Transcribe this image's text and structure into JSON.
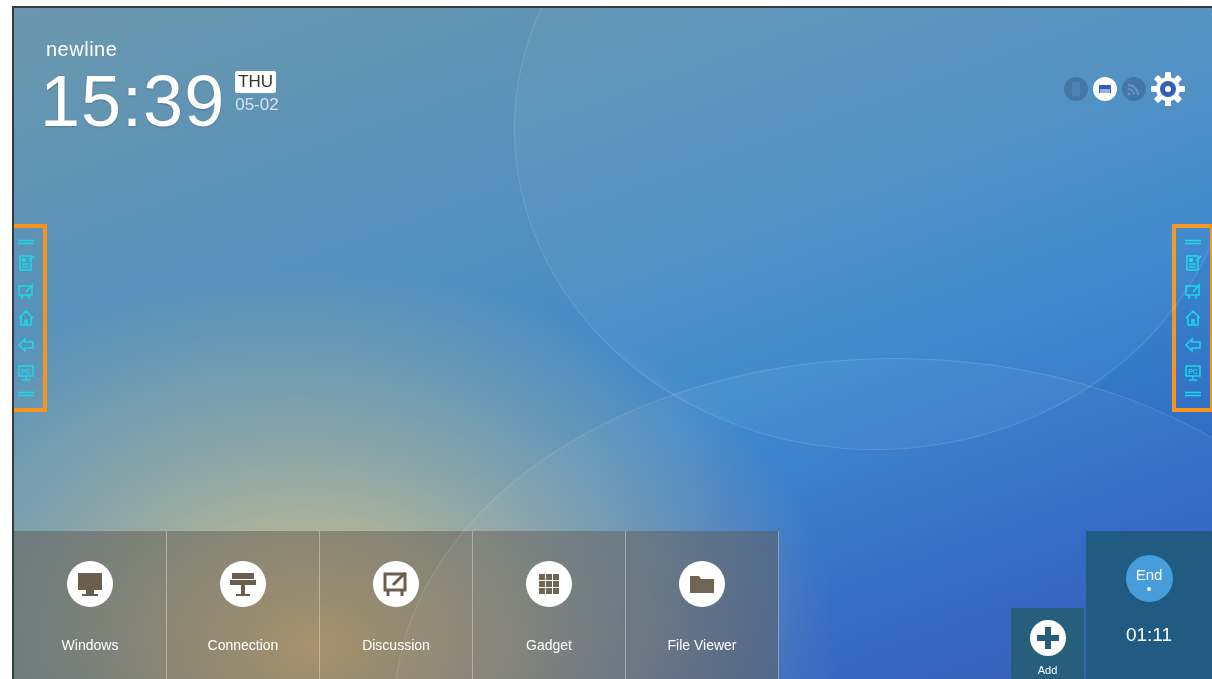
{
  "brand": "newline",
  "clock": {
    "time": "15:39",
    "weekday": "THU",
    "date": "05-02"
  },
  "status_icons": [
    {
      "kind": "usb",
      "on": false
    },
    {
      "kind": "ethernet",
      "on": true
    },
    {
      "kind": "wifi",
      "on": false
    },
    {
      "kind": "settings",
      "on": true
    }
  ],
  "side_toolbars": [
    {
      "kind": "left",
      "pc_label": "PC"
    },
    {
      "kind": "right",
      "pc_label": "PC"
    }
  ],
  "dock": [
    {
      "kind": "monitor",
      "label": "Windows"
    },
    {
      "kind": "connection",
      "label": "Connection"
    },
    {
      "kind": "discussion",
      "label": "Discussion"
    },
    {
      "kind": "grid",
      "label": "Gadget"
    },
    {
      "kind": "folder",
      "label": "File Viewer"
    }
  ],
  "add_button": {
    "label": "Add"
  },
  "session": {
    "button": "End",
    "timer": "01:11"
  }
}
